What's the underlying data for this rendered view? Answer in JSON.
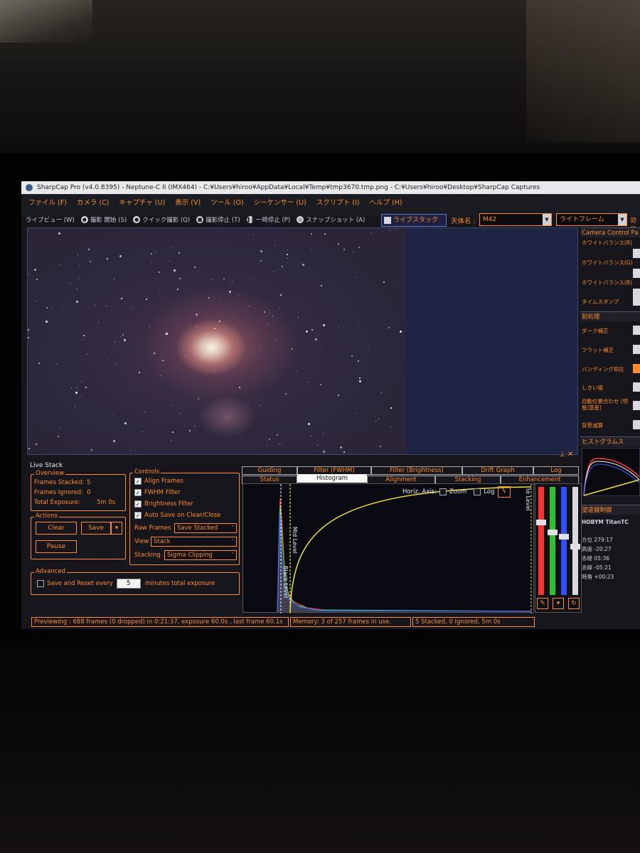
{
  "window": {
    "title": "SharpCap Pro (v4.0.8395) - Neptune-C II (IMX464) - C:¥Users¥hiroo¥AppData¥Local¥Temp¥tmp3670.tmp.png - C:¥Users¥hiroo¥Desktop¥SharpCap Captures"
  },
  "menu": {
    "items": [
      "ファイル (F)",
      "カメラ (C)",
      "キャプチャ (U)",
      "表示 (V)",
      "ツール (O)",
      "シーケンサー (U)",
      "スクリプト (I)",
      "ヘルプ (H)"
    ]
  },
  "toolbar": {
    "live_view": "ライブビュー (W)",
    "record": "撮影 開始 (S)",
    "quick_capture": "クイック撮影 (Q)",
    "stop": "撮影停止 (T)",
    "pause": "一時停止 (P)",
    "snapshot": "スナップショット (A)",
    "live_stack": "ライブスタック (L)",
    "target_label": "天体名 :",
    "target_value": "M42",
    "frame_type": "ライトフレーム",
    "effect": "効果"
  },
  "camera_panel": {
    "title": "Camera Control Pa",
    "wb_r": "ホワイトバランス(R)",
    "wb_g": "ホワイトバランス(G)",
    "wb_b": "ホワイトバランス(B)",
    "timestamp": "タイムスタンプ",
    "preprocess_header": "前処理",
    "dark": "ダーク補正",
    "flat": "フラット補正",
    "banding": "バンディング抑圧",
    "threshold": "しきい値",
    "auto_align": "自動位置合わせ (恒星/惑星)",
    "bg_sub": "背景減算",
    "histogram_header": "ヒストグラムス",
    "mount_header": "望遠鏡制御",
    "mount_name": "HOBYM TitanTC",
    "mount_rows": [
      "方位 279:17",
      "高度 -20:27",
      "赤経 05:36",
      "赤緯 -05:21",
      "時角 +00:23"
    ]
  },
  "live_stack": {
    "title": "Live Stack",
    "overview": {
      "label": "Overview",
      "frames_stacked_label": "Frames Stacked:",
      "frames_stacked": "5",
      "frames_ignored_label": "Frames Ignored:",
      "frames_ignored": "0",
      "total_exposure_label": "Total Exposure:",
      "total_exposure": "5m 0s"
    },
    "actions": {
      "label": "Actions",
      "clear": "Clear",
      "save": "Save",
      "pause": "Pause"
    },
    "controls": {
      "label": "Controls",
      "align_frames": "Align Frames",
      "fwhm_filter": "FWHM Filter",
      "brightness_filter": "Brightness Filter",
      "auto_save": "Auto Save on Clear/Close",
      "raw_frames_label": "Raw Frames",
      "raw_frames_value": "Save Stacked",
      "view_label": "View",
      "view_value": "Stack",
      "stacking_label": "Stacking",
      "stacking_value": "Sigma Clipping"
    },
    "advanced": {
      "label": "Advanced",
      "save_reset_prefix": "Save and Reset every",
      "minutes": "5",
      "save_reset_suffix": "minutes total exposure"
    },
    "tabs_top": [
      "Guiding",
      "Filter (FWHM)",
      "Filter (Brightness)",
      "Drift Graph",
      "Log"
    ],
    "tabs_bottom": [
      "Status",
      "Histogram",
      "Alignment",
      "Stacking",
      "Enhancement"
    ],
    "histogram": {
      "horiz_axis": "Horiz. Axis:",
      "zoom": "Zoom",
      "log": "Log",
      "mid_level": "Mid Level",
      "black_level": "Black Level",
      "white_level": "te Level"
    }
  },
  "status": {
    "preview": "Previewing : 688 frames (0 dropped) in 0:21:37, exposure 60.0s , last frame 60.1s",
    "memory": "Memory: 3 of 257 frames in use.",
    "stacked": "5 Stacked, 0 Ignored, 5m 0s"
  }
}
